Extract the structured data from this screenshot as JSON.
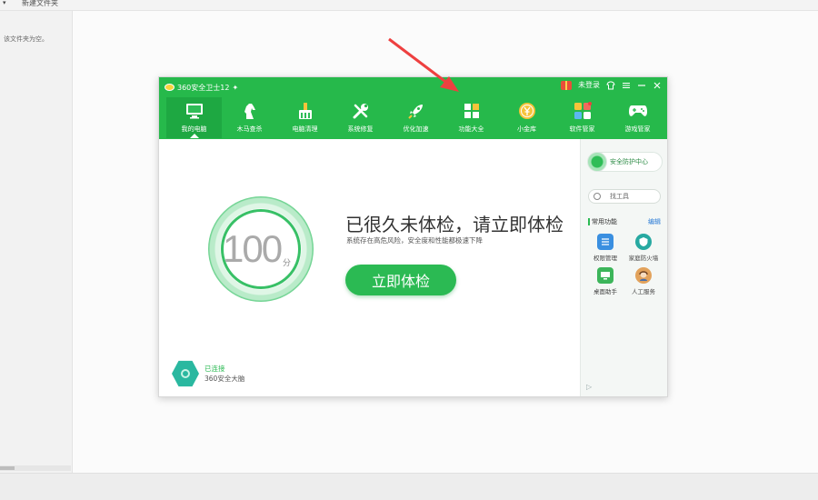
{
  "explorer": {
    "tab_label": "新建文件夹",
    "empty_text": "该文件夹为空。"
  },
  "window": {
    "title": "360安全卫士12",
    "login_label": "未登录",
    "nav": [
      {
        "label": "我的电脑",
        "icon": "monitor-icon"
      },
      {
        "label": "木马查杀",
        "icon": "horse-icon"
      },
      {
        "label": "电脑清理",
        "icon": "broom-icon"
      },
      {
        "label": "系统修复",
        "icon": "wrench-icon"
      },
      {
        "label": "优化加速",
        "icon": "rocket-icon"
      },
      {
        "label": "功能大全",
        "icon": "grid-icon"
      },
      {
        "label": "小金库",
        "icon": "coin-icon"
      },
      {
        "label": "软件管家",
        "icon": "apps-icon"
      },
      {
        "label": "游戏管家",
        "icon": "gamepad-icon"
      }
    ]
  },
  "main": {
    "score": "100",
    "score_unit": "分",
    "headline": "已很久未体检，请立即体检",
    "subline": "系统存在高危风险，安全度和性能都极速下降",
    "check_button": "立即体检",
    "brain_status": "已连接",
    "brain_name": "360安全大脑"
  },
  "sidebar": {
    "protection_center": "安全防护中心",
    "find_tools": "找工具",
    "common_title": "常用功能",
    "edit_label": "编辑",
    "tools": [
      {
        "label": "权限管理",
        "icon": "permission-icon",
        "color": "#3a8fe0"
      },
      {
        "label": "家庭防火墙",
        "icon": "firewall-icon",
        "color": "#27a9a1"
      },
      {
        "label": "桌面助手",
        "icon": "desktop-assistant-icon",
        "color": "#3cb55a"
      },
      {
        "label": "人工服务",
        "icon": "support-agent-icon",
        "color": "#e2a25b"
      }
    ]
  },
  "colors": {
    "brand_green": "#26b94b",
    "arrow_red": "#ee4040"
  }
}
